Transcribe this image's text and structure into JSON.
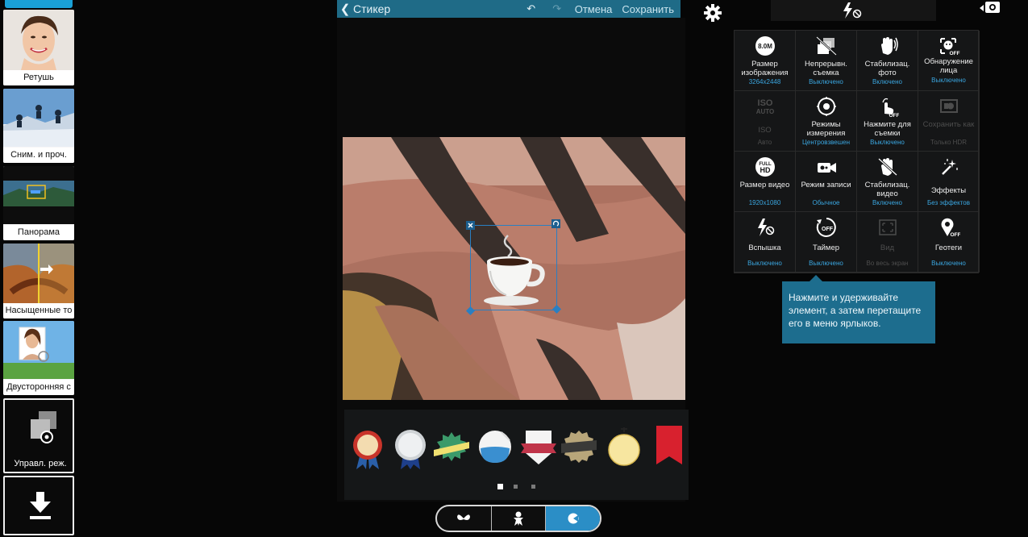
{
  "modes": [
    {
      "label": "Ретушь"
    },
    {
      "label": "Сним. и проч."
    },
    {
      "label": "Панорама"
    },
    {
      "label": "Насыщенные то"
    },
    {
      "label": "Двусторонняя с"
    },
    {
      "label": "Управл. реж."
    },
    {
      "label": ""
    }
  ],
  "editor": {
    "back_icon": "chevron-left-icon",
    "title": "Стикер",
    "undo_icon": "undo-icon",
    "redo_icon": "redo-icon",
    "cancel_label": "Отмена",
    "save_label": "Сохранить",
    "sticker_name": "coffee-cup-sticker",
    "pager": {
      "pages": 3,
      "current": 1
    },
    "tabs": [
      "frame-icon",
      "figure-icon",
      "sticker-icon"
    ],
    "active_tab": 2
  },
  "colors": {
    "accent": "#1aa0d6",
    "header": "#1f6b87",
    "value_text": "#3aa6e0",
    "tooltip_bg": "#1d6d8e",
    "active_tab": "#2b8ec6"
  },
  "settings": [
    {
      "icon": "8m-resolution-icon",
      "icon_text": "8.0M",
      "name": "Размер изображения",
      "value": "3264x2448",
      "disabled": false
    },
    {
      "icon": "burst-shot-icon",
      "name": "Непрерывн. съемка",
      "value": "Выключено",
      "disabled": false
    },
    {
      "icon": "hand-stabilization-icon",
      "name": "Стабилизац. фото",
      "value": "Включено",
      "disabled": false
    },
    {
      "icon": "face-detection-off-icon",
      "name": "Обнаружение лица",
      "value": "Выключено",
      "disabled": false
    },
    {
      "icon": "iso-auto-icon",
      "icon_text": "ISO",
      "icon_sub": "AUTO",
      "name": "ISO",
      "value": "Авто",
      "disabled": true
    },
    {
      "icon": "metering-icon",
      "name": "Режимы измерения",
      "value": "Центровзвешен",
      "disabled": false
    },
    {
      "icon": "tap-to-shoot-off-icon",
      "name": "Нажмите для съемки",
      "value": "Выключено",
      "disabled": false
    },
    {
      "icon": "save-as-hdr-icon",
      "name": "Сохранить как",
      "value": "Только HDR",
      "disabled": true
    },
    {
      "icon": "full-hd-icon",
      "icon_text": "FULL",
      "icon_sub": "HD",
      "name": "Размер видео",
      "value": "1920x1080",
      "disabled": false
    },
    {
      "icon": "video-record-mode-icon",
      "name": "Режим записи",
      "value": "Обычное",
      "disabled": false
    },
    {
      "icon": "video-stabilization-off-icon",
      "name": "Стабилизац. видео",
      "value": "Включено",
      "disabled": false
    },
    {
      "icon": "effects-icon",
      "name": "Эффекты",
      "value": "Без эффектов",
      "disabled": false
    },
    {
      "icon": "flash-off-icon",
      "name": "Вспышка",
      "value": "Выключено",
      "disabled": false
    },
    {
      "icon": "timer-off-icon",
      "icon_text": "OFF",
      "name": "Таймер",
      "value": "Выключено",
      "disabled": false
    },
    {
      "icon": "viewfinder-icon",
      "name": "Вид",
      "value": "Во весь экран",
      "disabled": true
    },
    {
      "icon": "geotag-off-icon",
      "name": "Геотеги",
      "value": "Выключено",
      "disabled": false
    }
  ],
  "tooltip": {
    "text": "Нажмите и удерживайте элемент, а затем перетащите его в меню ярлыков."
  },
  "top_bar": {
    "settings_icon": "gear-icon",
    "flash_icon": "flash-off-icon",
    "switch_icon": "camera-switch-icon"
  }
}
